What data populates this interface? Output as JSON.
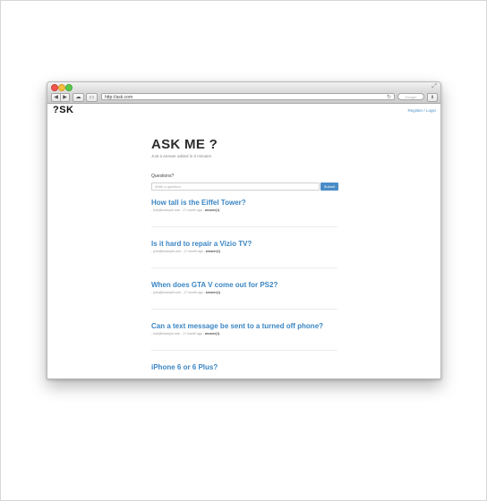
{
  "browser": {
    "url": "http://ask.com",
    "search_placeholder": "Google"
  },
  "header": {
    "logo": "?SK",
    "nav_link": "Register / Login"
  },
  "main": {
    "title": "ASK ME ?",
    "subtitle": "Just a answer added in 5 minutes",
    "question_label": "Questions?",
    "input_placeholder": "Write a question",
    "submit_label": "Submit"
  },
  "questions": [
    {
      "title": "How tall is the Eiffel Tower?",
      "meta": "- bob@example.com - 17 month ago -",
      "answers": "answer(1)"
    },
    {
      "title": "Is it hard to repair a Vizio TV?",
      "meta": "- john@example.com - 17 month ago -",
      "answers": "answer(1)"
    },
    {
      "title": "When does GTA V come out for PS2?",
      "meta": "- john@example.com - 17 month ago -",
      "answers": "answer(1)"
    },
    {
      "title": "Can a text message be sent to a turned off phone?",
      "meta": "- bob@example.com - 17 month ago -",
      "answers": "answer(1)"
    },
    {
      "title": "iPhone 6 or 6 Plus?",
      "meta": "",
      "answers": ""
    }
  ]
}
